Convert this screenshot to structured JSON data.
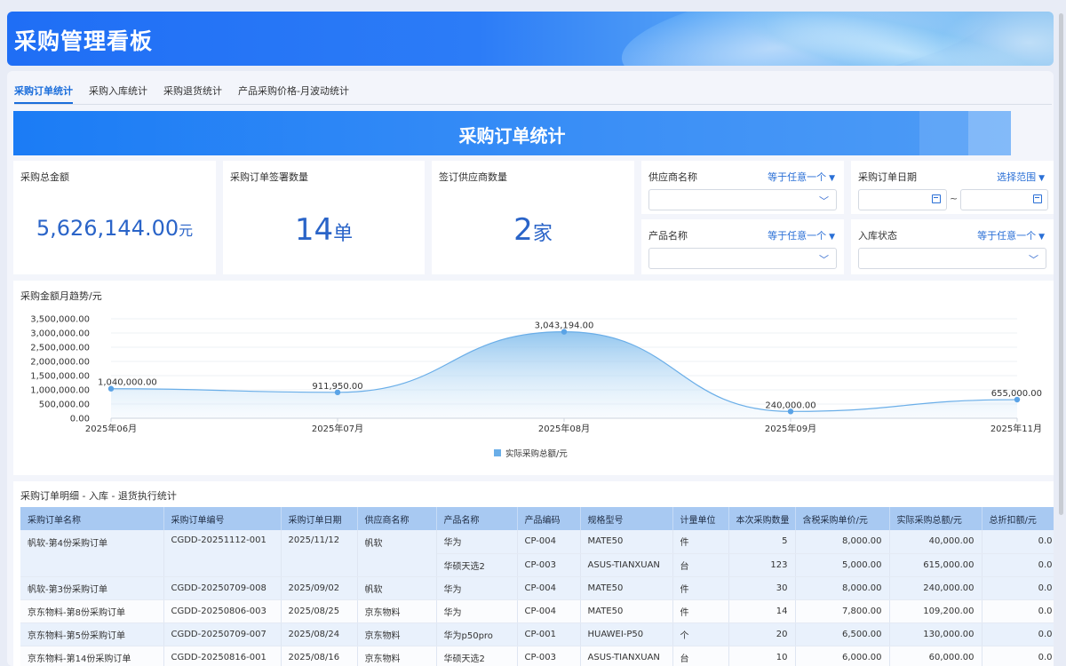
{
  "header": {
    "title": "采购管理看板"
  },
  "tabs": [
    {
      "label": "采购订单统计",
      "active": true
    },
    {
      "label": "采购入库统计",
      "active": false
    },
    {
      "label": "采购退货统计",
      "active": false
    },
    {
      "label": "产品采购价格-月波动统计",
      "active": false
    }
  ],
  "section": {
    "title": "采购订单统计"
  },
  "kpis": {
    "total_amount": {
      "label": "采购总金额",
      "value": "5,626,144.00",
      "unit": "元"
    },
    "order_count": {
      "label": "采购订单签署数量",
      "value": "14",
      "unit": "单"
    },
    "supplier_count": {
      "label": "签订供应商数量",
      "value": "2",
      "unit": "家"
    }
  },
  "filters": {
    "supplier": {
      "label": "供应商名称",
      "mode": "等于任意一个"
    },
    "order_date": {
      "label": "采购订单日期",
      "mode": "选择范围",
      "separator": "~"
    },
    "product": {
      "label": "产品名称",
      "mode": "等于任意一个"
    },
    "stock_status": {
      "label": "入库状态",
      "mode": "等于任意一个"
    }
  },
  "chart_title": "采购金额月趋势/元",
  "chart_data": {
    "type": "area",
    "categories": [
      "2025年06月",
      "2025年07月",
      "2025年08月",
      "2025年09月",
      "2025年11月"
    ],
    "series": [
      {
        "name": "实际采购总额/元",
        "values": [
          1040000,
          911950,
          3043194,
          240000,
          655000
        ]
      }
    ],
    "data_labels": [
      "1,040,000.00",
      "911,950.00",
      "3,043,194.00",
      "240,000.00",
      "655,000.00"
    ],
    "y_ticks": [
      "3,500,000.00",
      "3,000,000.00",
      "2,500,000.00",
      "2,000,000.00",
      "1,500,000.00",
      "1,000,000.00",
      "500,000.00",
      "0.00"
    ],
    "ylim": [
      0,
      3500000
    ],
    "legend_position": "bottom",
    "color": "#6aaee8"
  },
  "table": {
    "title": "采购订单明细 - 入库 - 退货执行统计",
    "columns": [
      "采购订单名称",
      "采购订单编号",
      "采购订单日期",
      "供应商名称",
      "产品名称",
      "产品编码",
      "规格型号",
      "计量单位",
      "本次采购数量",
      "含税采购单价/元",
      "实际采购总额/元",
      "总折扣额/元"
    ],
    "rows": [
      [
        "帆软-第4份采购订单",
        "CGDD-20251112-001",
        "2025/11/12",
        "帆软",
        "华为",
        "CP-004",
        "MATE50",
        "件",
        "5",
        "8,000.00",
        "40,000.00",
        "0.0"
      ],
      [
        "",
        "",
        "",
        "",
        "华硕天选2",
        "CP-003",
        "ASUS-TIANXUAN",
        "台",
        "123",
        "5,000.00",
        "615,000.00",
        "0.0"
      ],
      [
        "帆软-第3份采购订单",
        "CGDD-20250709-008",
        "2025/09/02",
        "帆软",
        "华为",
        "CP-004",
        "MATE50",
        "件",
        "30",
        "8,000.00",
        "240,000.00",
        "0.0"
      ],
      [
        "京东物料-第8份采购订单",
        "CGDD-20250806-003",
        "2025/08/25",
        "京东物料",
        "华为",
        "CP-004",
        "MATE50",
        "件",
        "14",
        "7,800.00",
        "109,200.00",
        "0.0"
      ],
      [
        "京东物料-第5份采购订单",
        "CGDD-20250709-007",
        "2025/08/24",
        "京东物料",
        "华为p50pro",
        "CP-001",
        "HUAWEI-P50",
        "个",
        "20",
        "6,500.00",
        "130,000.00",
        "0.0"
      ],
      [
        "京东物料-第14份采购订单",
        "CGDD-20250816-001",
        "2025/08/16",
        "京东物料",
        "华硕天选2",
        "CP-003",
        "ASUS-TIANXUAN",
        "台",
        "10",
        "6,000.00",
        "60,000.00",
        "0.0"
      ]
    ]
  }
}
